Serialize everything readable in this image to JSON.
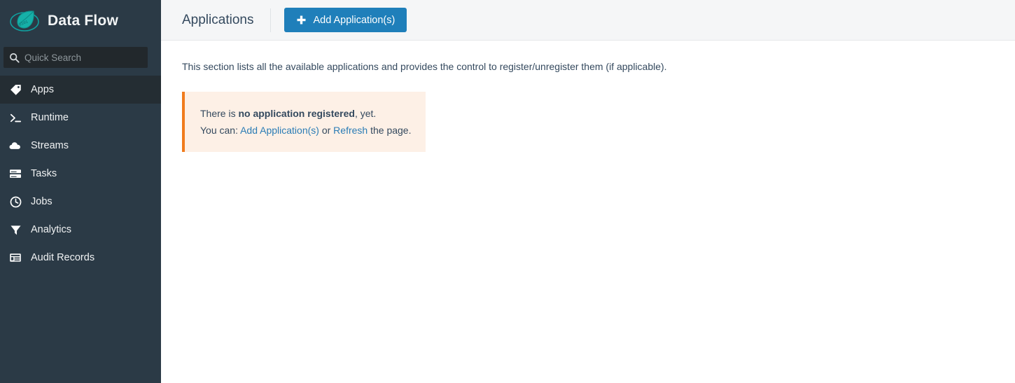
{
  "sidebar": {
    "brand": {
      "title": "Data Flow",
      "logo_icon": "spring-cloud-dataflow-logo"
    },
    "search": {
      "placeholder": "Quick Search",
      "value": "",
      "icon": "search-icon"
    },
    "items": [
      {
        "label": "Apps",
        "icon": "tag-icon",
        "active": true
      },
      {
        "label": "Runtime",
        "icon": "terminal-icon",
        "active": false
      },
      {
        "label": "Streams",
        "icon": "cloud-icon",
        "active": false
      },
      {
        "label": "Tasks",
        "icon": "server-icon",
        "active": false
      },
      {
        "label": "Jobs",
        "icon": "clock-icon",
        "active": false
      },
      {
        "label": "Analytics",
        "icon": "filter-icon",
        "active": false
      },
      {
        "label": "Audit Records",
        "icon": "list-icon",
        "active": false
      }
    ]
  },
  "topbar": {
    "title": "Applications",
    "add_button": {
      "label": "Add Application(s)",
      "icon": "plus-icon"
    }
  },
  "content": {
    "lead": "This section lists all the available applications and provides the control to register/unregister them (if applicable).",
    "alert": {
      "line1_prefix": "There is ",
      "line1_bold": "no application registered",
      "line1_suffix": ", yet.",
      "line2_prefix": "You can: ",
      "line2_link1": "Add Application(s)",
      "line2_middle": " or ",
      "line2_link2": "Refresh",
      "line2_suffix": " the page."
    }
  },
  "colors": {
    "sidebar_bg": "#2b3a46",
    "sidebar_active": "#242d33",
    "search_bg": "#22282c",
    "accent_blue": "#1f7fba",
    "link_blue": "#2a7cb5",
    "alert_bg": "#fdf0e6",
    "alert_border": "#f07c1e",
    "text_dark": "#34495e",
    "logo_teal": "#10a0a0",
    "topbar_bg": "#f5f6f7"
  }
}
